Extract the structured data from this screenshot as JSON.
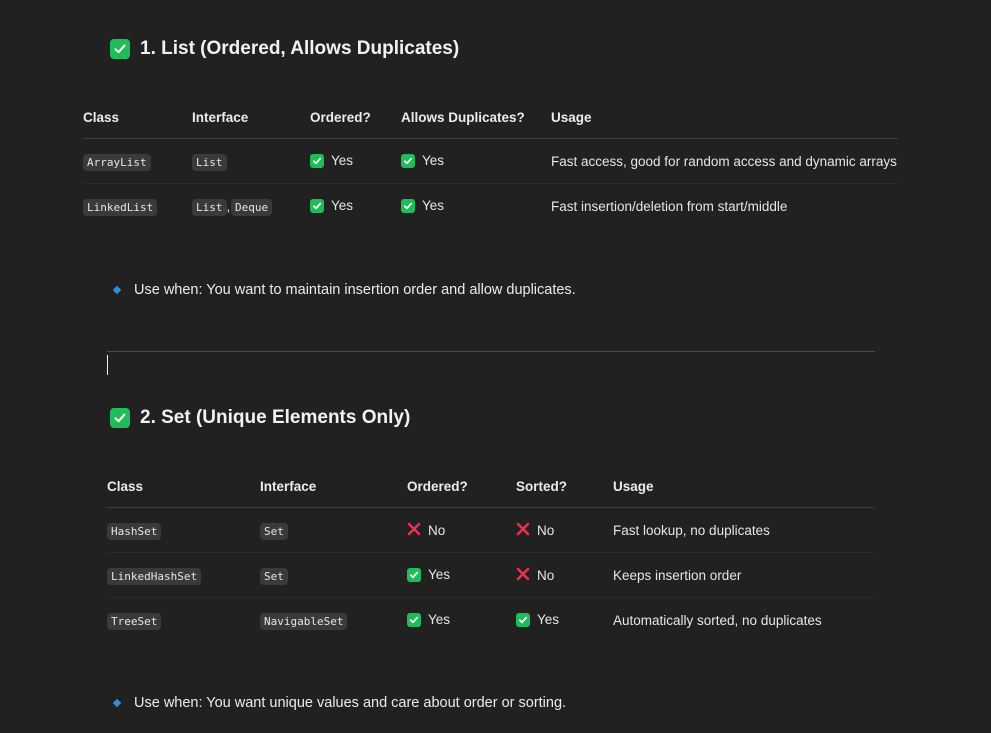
{
  "section1": {
    "heading": "1. List (Ordered, Allows Duplicates)",
    "columns": [
      "Class",
      "Interface",
      "Ordered?",
      "Allows Duplicates?",
      "Usage"
    ],
    "rows": [
      {
        "class": "ArrayList",
        "interfaces": [
          "List"
        ],
        "ordered": {
          "icon": "check-icon",
          "label": "Yes"
        },
        "duplicates": {
          "icon": "check-icon",
          "label": "Yes"
        },
        "usage": "Fast access, good for random access and dynamic arrays"
      },
      {
        "class": "LinkedList",
        "interfaces": [
          "List",
          "Deque"
        ],
        "interface_separator": ",",
        "ordered": {
          "icon": "check-icon",
          "label": "Yes"
        },
        "duplicates": {
          "icon": "check-icon",
          "label": "Yes"
        },
        "usage": "Fast insertion/deletion from start/middle"
      }
    ],
    "note": "Use when: You want to maintain insertion order and allow duplicates."
  },
  "section2": {
    "heading": "2. Set (Unique Elements Only)",
    "columns": [
      "Class",
      "Interface",
      "Ordered?",
      "Sorted?",
      "Usage"
    ],
    "rows": [
      {
        "class": "HashSet",
        "interface": "Set",
        "ordered": {
          "icon": "cross-icon",
          "label": "No"
        },
        "sorted": {
          "icon": "cross-icon",
          "label": "No"
        },
        "usage": "Fast lookup, no duplicates"
      },
      {
        "class": "LinkedHashSet",
        "interface": "Set",
        "ordered": {
          "icon": "check-icon",
          "label": "Yes"
        },
        "sorted": {
          "icon": "cross-icon",
          "label": "No"
        },
        "usage": "Keeps insertion order"
      },
      {
        "class": "TreeSet",
        "interface": "NavigableSet",
        "ordered": {
          "icon": "check-icon",
          "label": "Yes"
        },
        "sorted": {
          "icon": "check-icon",
          "label": "Yes"
        },
        "usage": "Automatically sorted, no duplicates"
      }
    ],
    "note": "Use when: You want unique values and care about order or sorting."
  },
  "colors": {
    "background": "#212121",
    "check": "#1fbd5a",
    "cross": "#e5334f",
    "bullet": "#2f8fd8"
  }
}
